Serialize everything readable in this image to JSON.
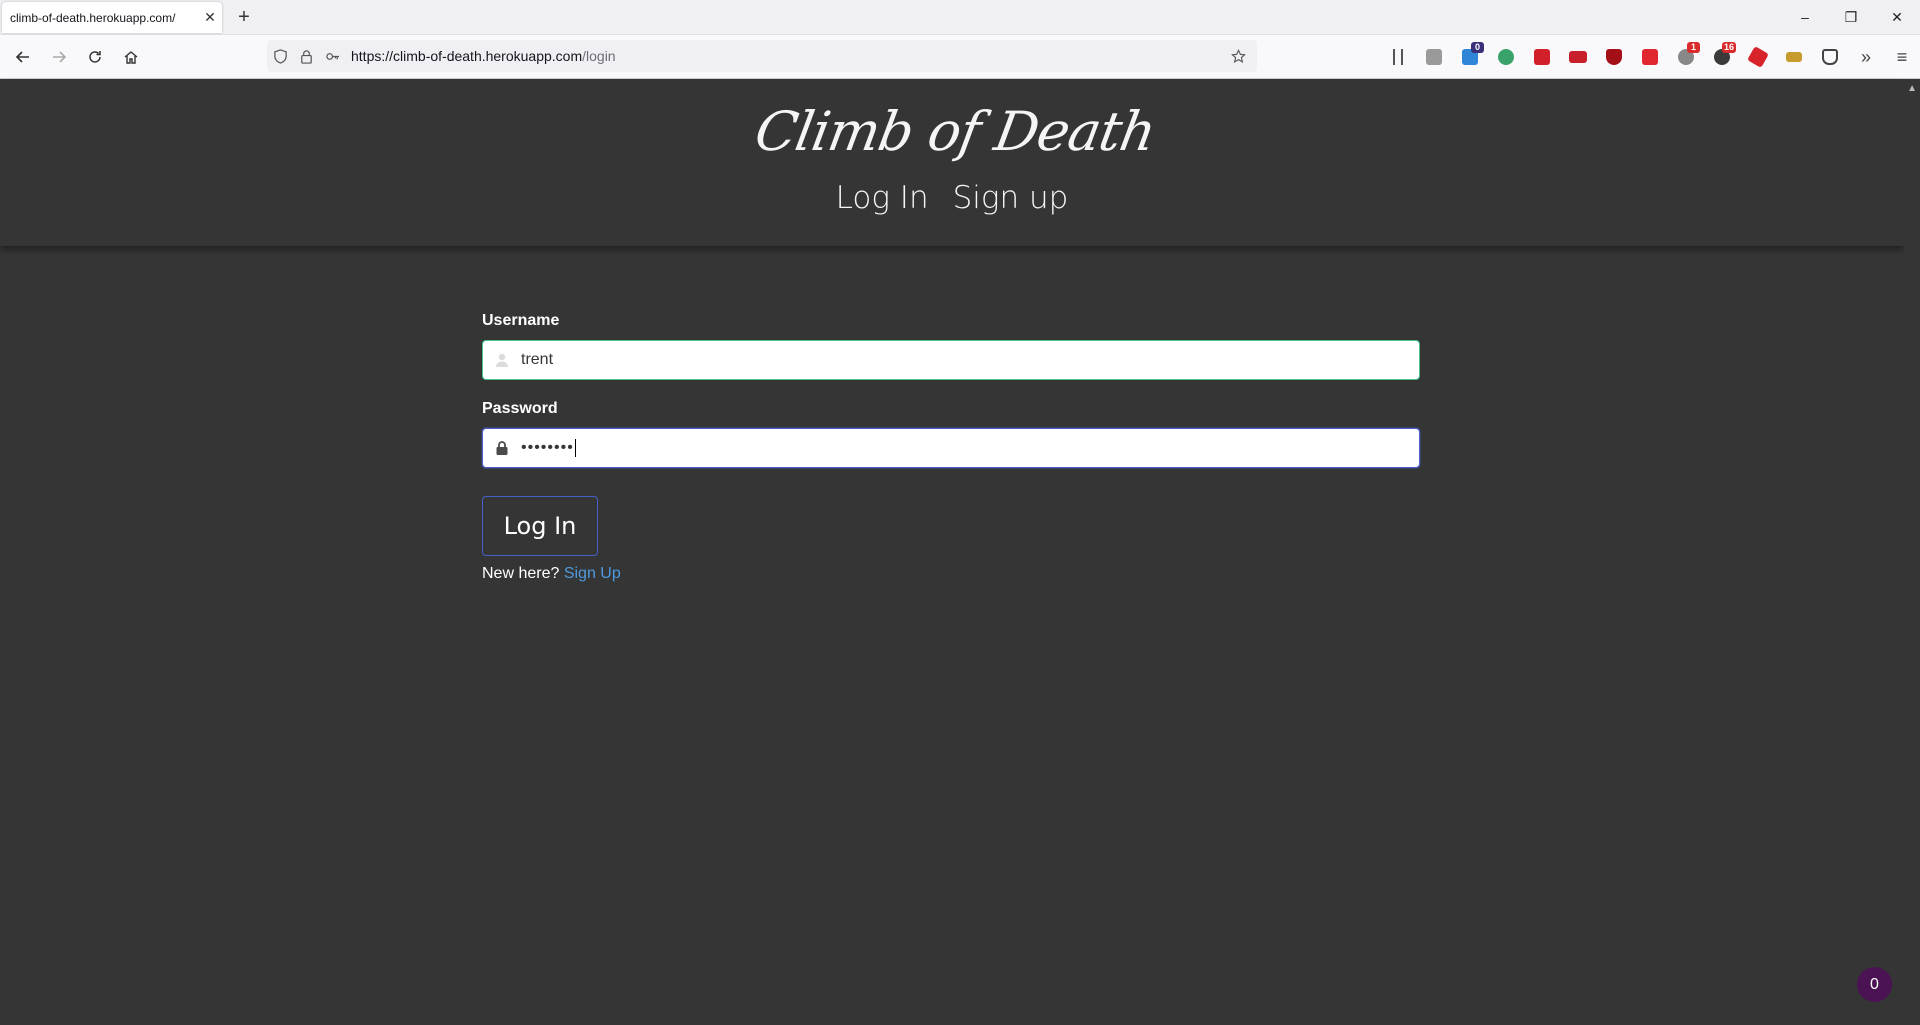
{
  "browser": {
    "tab_title": "climb-of-death.herokuapp.com/",
    "tab_close_icon": "close-icon",
    "new_tab_label": "+",
    "url_host": "https://climb-of-death.herokuapp.com",
    "url_path": "/login",
    "window": {
      "minimize": "–",
      "restore": "❐",
      "close": "✕"
    },
    "toolbar_badges": {
      "extension_a": "0",
      "extension_b": "1",
      "extension_c": "16"
    }
  },
  "site": {
    "logo_text": "Climb of Death",
    "nav": {
      "login": "Log In",
      "signup": "Sign up"
    }
  },
  "form": {
    "username_label": "Username",
    "username_value": "trent",
    "password_label": "Password",
    "password_value": "••••••••",
    "submit_label": "Log In",
    "new_here_text": "New here?",
    "signup_link": "Sign Up"
  },
  "widget": {
    "counter": "0"
  },
  "colors": {
    "page_bg": "#353535",
    "success_border": "#48c78e",
    "focus_border": "#485fc7",
    "link": "#4f9ae0",
    "counter_bg": "#4b1354"
  }
}
